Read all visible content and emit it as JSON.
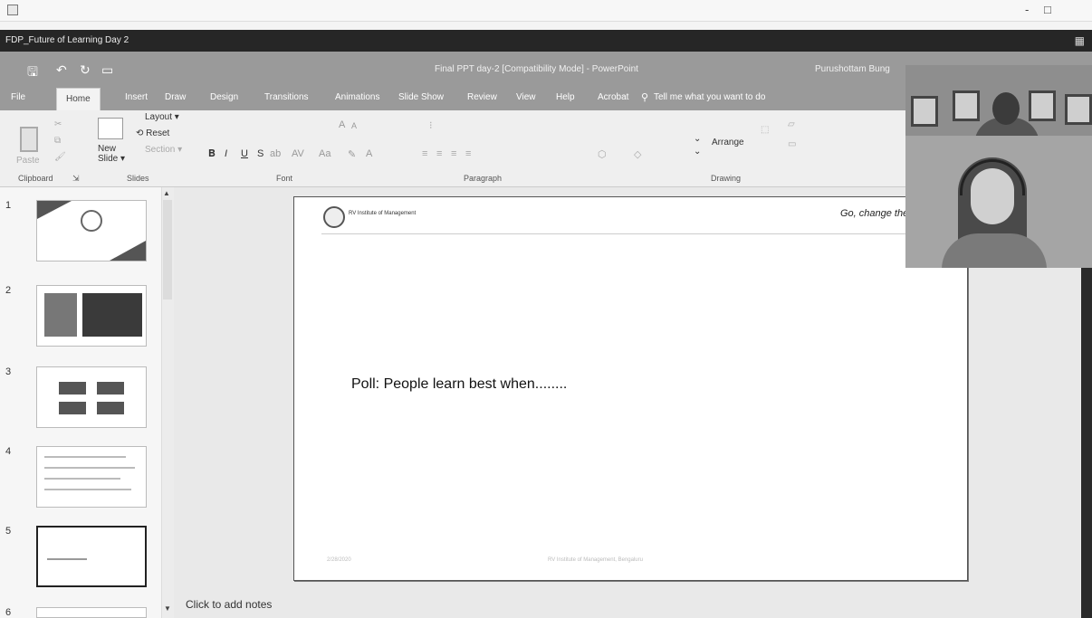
{
  "meeting": {
    "title": "FDP_Future of Learning Day 2",
    "window_minimize": "-",
    "window_restore": "□"
  },
  "window": {
    "title": "Final PPT day-2 [Compatibility Mode] - PowerPoint",
    "user": "Purushottam Bung"
  },
  "ribbon": {
    "tabs": [
      "File",
      "Home",
      "Insert",
      "Draw",
      "Design",
      "Transitions",
      "Animations",
      "Slide Show",
      "Review",
      "View",
      "Help",
      "Acrobat"
    ],
    "active_tab": "Home",
    "tell_me": "Tell me what you want to do",
    "paste_label": "Paste",
    "new_slide_label": "New\nSlide ▾",
    "layout_label": "Layout ▾",
    "reset_label": "Reset",
    "section_label": "Section ▾",
    "arrange_label": "Arrange",
    "groups": [
      "Clipboard",
      "Slides",
      "Font",
      "Paragraph",
      "Drawing"
    ]
  },
  "thumbnails": {
    "numbers": [
      "1",
      "2",
      "3",
      "4",
      "5",
      "6"
    ],
    "selected": "5"
  },
  "slide": {
    "logo_text": "RV Institute of Management",
    "tagline": "Go, change the world",
    "body": "Poll: People learn best when........",
    "footer_left": "2/28/2020",
    "footer_center": "RV Institute of Management, Bengaluru"
  },
  "notes": {
    "placeholder": "Click to add notes"
  },
  "icons": [
    "app-icon",
    "grid-icon",
    "save-icon",
    "undo-icon",
    "redo-icon",
    "lightbulb-icon",
    "paste-icon",
    "new-slide-icon",
    "scroll-up-icon",
    "scroll-down-icon"
  ]
}
